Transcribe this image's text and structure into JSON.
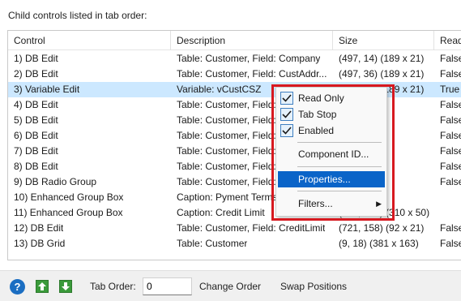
{
  "heading": "Child controls listed in tab order:",
  "columns": [
    "Control",
    "Description",
    "Size",
    "Read"
  ],
  "rows": [
    {
      "control": "1) DB Edit",
      "description": "Table: Customer, Field: Company",
      "size": "(497, 14) (189 x 21)",
      "read": "False"
    },
    {
      "control": "2) DB Edit",
      "description": "Table: Customer, Field: CustAddr...",
      "size": "(497, 36) (189 x 21)",
      "read": "False"
    },
    {
      "control": "3) Variable Edit",
      "description": "Variable: vCustCSZ",
      "size": "(497, 58) (189 x 21)",
      "read": "True"
    },
    {
      "control": "4) DB Edit",
      "description": "Table: Customer, Field: C",
      "size": "9 x 21)",
      "read": "False"
    },
    {
      "control": "5) DB Edit",
      "description": "Table: Customer, Field: C",
      "size": "9 x 21)",
      "read": "False"
    },
    {
      "control": "6) DB Edit",
      "description": "Table: Customer, Field: C",
      "size": "9 x 21)",
      "read": "False"
    },
    {
      "control": "7) DB Edit",
      "description": "Table: Customer, Field: I",
      "size": "9 x 21)",
      "read": "False"
    },
    {
      "control": "8) DB Edit",
      "description": "Table: Customer, Field: I",
      "size": "9 x 21)",
      "read": "False"
    },
    {
      "control": "9) DB Radio Group",
      "description": "Table: Customer, Field: C",
      "size": "9 x 65)",
      "read": "False"
    },
    {
      "control": "10) Enhanced Group Box",
      "description": "Caption: Pyment Terms",
      "size": "0 x 50)",
      "read": ""
    },
    {
      "control": "11) Enhanced Group Box",
      "description": "Caption: Credit Limit",
      "size": "(715, 147) (310 x 50)",
      "read": ""
    },
    {
      "control": "12) DB Edit",
      "description": "Table: Customer, Field: CreditLimit",
      "size": "(721, 158) (92 x 21)",
      "read": "False"
    },
    {
      "control": "13) DB Grid",
      "description": "Table: Customer",
      "size": "(9, 18) (381 x 163)",
      "read": "False"
    }
  ],
  "selected_row": 2,
  "context_menu": {
    "read_only": "Read Only",
    "tab_stop": "Tab Stop",
    "enabled": "Enabled",
    "component_id": "Component ID...",
    "properties": "Properties...",
    "filters": "Filters...",
    "submenu_arrow": "▶"
  },
  "footer": {
    "help": "?",
    "tab_order_label": "Tab Order:",
    "tab_order_value": "0",
    "change_order": "Change Order",
    "swap_positions": "Swap Positions"
  },
  "colors": {
    "selection": "#cce8ff",
    "menu_highlight": "#0a64c8",
    "annotation_red": "#d71920"
  },
  "icons": {
    "help": "help-icon",
    "move_up": "arrow-up-icon",
    "move_down": "arrow-down-icon",
    "check": "checkmark-icon",
    "submenu": "chevron-right-icon"
  }
}
